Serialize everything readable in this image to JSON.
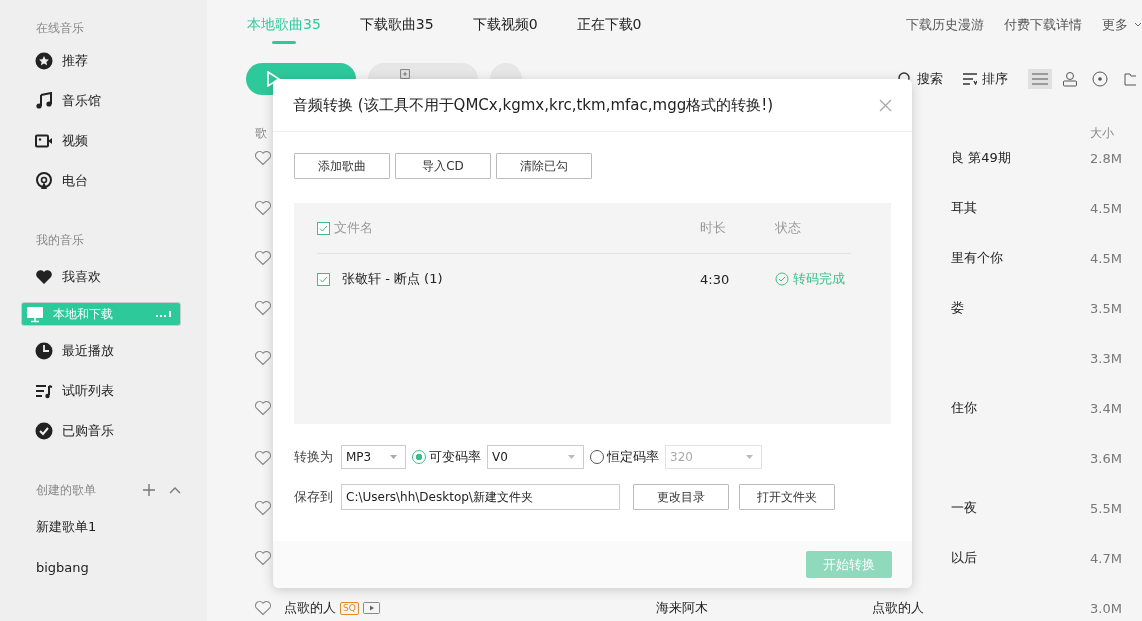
{
  "sidebar": {
    "sections": [
      {
        "title": "在线音乐",
        "items": [
          {
            "label": "推荐",
            "selected": false
          },
          {
            "label": "音乐馆",
            "selected": false
          },
          {
            "label": "视频",
            "selected": false
          },
          {
            "label": "电台",
            "selected": false
          }
        ]
      },
      {
        "title": "我的音乐",
        "items": [
          {
            "label": "我喜欢",
            "selected": false
          },
          {
            "label": "本地和下载",
            "selected": true
          },
          {
            "label": "最近播放",
            "selected": false
          },
          {
            "label": "试听列表",
            "selected": false
          },
          {
            "label": "已购音乐",
            "selected": false
          }
        ]
      },
      {
        "title": "创建的歌单",
        "items": [
          {
            "label": "新建歌单1",
            "selected": false
          },
          {
            "label": "bigbang",
            "selected": false
          }
        ]
      }
    ]
  },
  "tabs": [
    {
      "label": "本地歌曲35",
      "selected": true
    },
    {
      "label": "下载歌曲35",
      "selected": false
    },
    {
      "label": "下载视频0",
      "selected": false
    },
    {
      "label": "正在下载0",
      "selected": false
    }
  ],
  "top_links": [
    "下载历史漫游",
    "付费下载详情",
    "更多"
  ],
  "toolbar": {
    "search": "搜索",
    "sort": "排序",
    "views": [
      {
        "selected": true
      },
      {
        "selected": false
      },
      {
        "selected": false
      },
      {
        "selected": false
      }
    ]
  },
  "song_list": {
    "columns": [
      "歌",
      "大小"
    ],
    "rows": [
      {
        "kind": "covered",
        "album": "良 第49期",
        "size": "2.8M"
      },
      {
        "kind": "covered",
        "album": "耳其",
        "size": "4.5M"
      },
      {
        "kind": "covered",
        "album": "里有个你",
        "size": "4.5M"
      },
      {
        "kind": "covered",
        "album": "娄",
        "size": "3.5M"
      },
      {
        "kind": "covered",
        "size": "3.3M"
      },
      {
        "kind": "covered",
        "album": "住你",
        "size": "3.4M"
      },
      {
        "kind": "covered",
        "size": "3.6M"
      },
      {
        "kind": "covered",
        "album": "一夜",
        "size": "5.5M"
      },
      {
        "kind": "covered",
        "album": "以后",
        "size": "4.7M"
      },
      {
        "kind": "full",
        "title": "点歌的人",
        "badge": "SQ",
        "has_mv": true,
        "singer": "海来阿木",
        "album": "点歌的人",
        "size": "3.0M"
      }
    ]
  },
  "dialog": {
    "title": "音频转换 (该工具不用于QMCx,kgmx,krc,tkm,mfac,mgg格式的转换!)",
    "buttons": [
      "添加歌曲",
      "导入CD",
      "清除已勾"
    ],
    "file_table": {
      "all_checked": true,
      "columns": [
        "文件名",
        "时长",
        "状态"
      ],
      "rows": [
        {
          "checked": true,
          "name": "张敬轩 - 断点 (1)",
          "duration": "4:30",
          "status": "转码完成"
        }
      ]
    },
    "format": {
      "label": "转换为",
      "value": "MP3"
    },
    "bitrate_options": [
      {
        "label": "可变码率",
        "selected": true,
        "value": "V0"
      },
      {
        "label": "恒定码率",
        "selected": false,
        "value": "320"
      }
    ],
    "save": {
      "label": "保存到",
      "value": "C:\\Users\\hh\\Desktop\\新建文件夹",
      "buttons": [
        "更改目录",
        "打开文件夹"
      ]
    },
    "start_button": {
      "label": "开始转换",
      "disabled": true
    }
  }
}
